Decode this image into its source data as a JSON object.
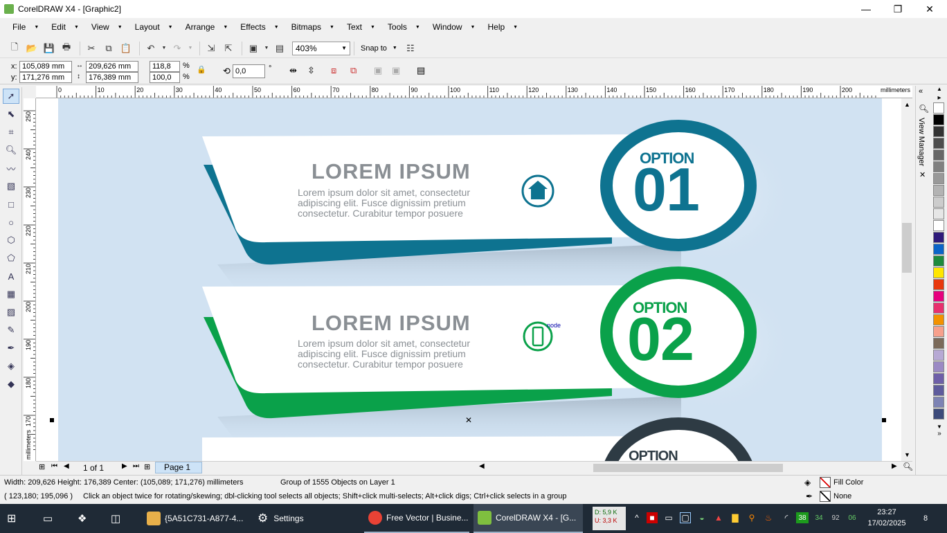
{
  "window": {
    "title": "CorelDRAW X4 - [Graphic2]",
    "minimize": "—",
    "restore": "❐",
    "close": "✕"
  },
  "menu": [
    "File",
    "Edit",
    "View",
    "Layout",
    "Arrange",
    "Effects",
    "Bitmaps",
    "Text",
    "Tools",
    "Window",
    "Help"
  ],
  "toolbar": {
    "zoom": "403%",
    "snap_to": "Snap to"
  },
  "property_bar": {
    "x_label": "x:",
    "x": "105,089 mm",
    "y_label": "y:",
    "y": "171,276 mm",
    "width": "209,626 mm",
    "height": "176,389 mm",
    "scale_x": "118,8",
    "scale_y": "100,0",
    "pct": "%",
    "rotation": "0,0",
    "deg": "°"
  },
  "ruler": {
    "unit": "millimeters",
    "h_ticks": [
      "0",
      "10",
      "20",
      "30",
      "40",
      "50",
      "60",
      "70",
      "80",
      "90",
      "100",
      "110",
      "120",
      "130",
      "140",
      "150",
      "160",
      "170",
      "180",
      "190",
      "200"
    ],
    "v_ticks": [
      "250",
      "240",
      "230",
      "220",
      "210",
      "200",
      "190",
      "180",
      "170"
    ],
    "v_unit": "millimeters"
  },
  "artwork": {
    "items": [
      {
        "heading": "LOREM IPSUM",
        "body": "Lorem ipsum dolor sit amet, consectetur adipiscing elit. Fusce dignissim pretium consectetur. Curabitur tempor posuere",
        "option_label": "OPTION",
        "option_number": "01",
        "color": "#0e7390",
        "icon": "home-icon"
      },
      {
        "heading": "LOREM IPSUM",
        "body": "Lorem ipsum dolor sit amet, consectetur adipiscing elit. Fusce dignissim pretium consectetur. Curabitur tempor posuere",
        "option_label": "OPTION",
        "option_number": "02",
        "color": "#0aa14a",
        "icon": "mobile-phone-icon"
      },
      {
        "option_label": "OPTION",
        "color": "#2e3b44"
      }
    ],
    "node_label": "node"
  },
  "page_nav": {
    "page_count": "1 of 1",
    "page_tab": "Page 1"
  },
  "view_manager": "View Manager",
  "palette": [
    "#ffffff",
    "#000000",
    "#333333",
    "#4d4d4d",
    "#666666",
    "#808080",
    "#999999",
    "#b3b3b3",
    "#cccccc",
    "#e6e6e6",
    "#ffffff",
    "#2e1a7a",
    "#0b64c8",
    "#1e8a3c",
    "#ffe600",
    "#e8380d",
    "#e6007e",
    "#e8306e",
    "#f39200",
    "#f7a08c",
    "#7b6a5a",
    "#b7a9d4",
    "#9b8ac4",
    "#6e5fa8",
    "#5e5b9c",
    "#7d83b4",
    "#3c4a7a"
  ],
  "status": {
    "line1_dims": "Width: 209,626  Height: 176,389  Center: (105,089; 171,276)  millimeters",
    "line1_group": "Group of 1555 Objects on Layer 1",
    "line2_coords": "( 123,180; 195,096 )",
    "line2_hint": "Click an object twice for rotating/skewing; dbl-clicking tool selects all objects; Shift+click multi-selects; Alt+click digs; Ctrl+click selects in a group",
    "fill": "Fill Color",
    "outline": "None"
  },
  "taskbar": {
    "items": [
      {
        "label": "{5A51C731-A877-4...",
        "color": "#e8b04a"
      },
      {
        "label": "Settings",
        "color": "#5a6470"
      },
      {
        "label": "Free Vector | Busine...",
        "color": "#e94235"
      },
      {
        "label": "CorelDRAW X4 - [G...",
        "color": "#7fbf3f"
      }
    ],
    "disk": {
      "d": "D: 5,9 K",
      "u": "U: 3,3 K"
    },
    "tray_badges": [
      "38",
      "34",
      "92",
      "06"
    ],
    "time": "23:27",
    "date": "17/02/2025",
    "notifications": "8"
  }
}
